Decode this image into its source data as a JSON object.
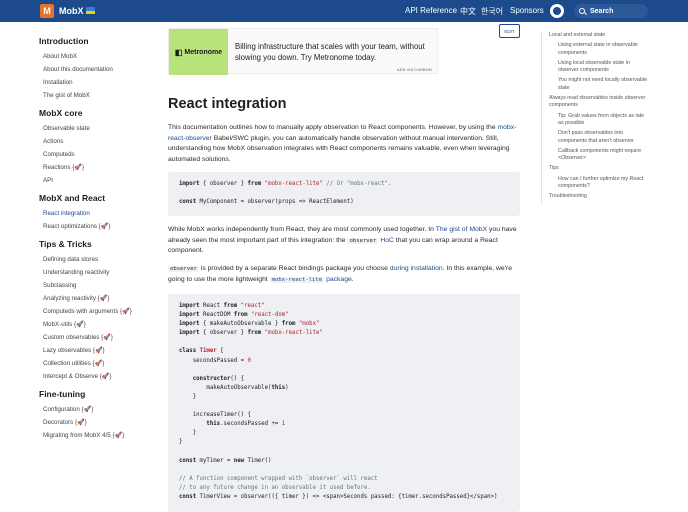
{
  "navbar": {
    "brand": "MobX",
    "links": [
      "API Reference",
      "中文",
      "한국어",
      "Sponsors"
    ],
    "search_label": "Search",
    "logo_icon": "mobx-logo-icon",
    "github_icon": "github-icon"
  },
  "sidebar": {
    "sections": [
      {
        "title": "Introduction",
        "items": [
          "About MobX",
          "About this documentation",
          "Installation",
          "The gist of MobX"
        ]
      },
      {
        "title": "MobX core",
        "items": [
          "Observable state",
          "Actions",
          "Computeds",
          "Reactions {🚀}",
          "API"
        ]
      },
      {
        "title": "MobX and React",
        "items": [
          "React integration",
          "React optimizations {🚀}"
        ]
      },
      {
        "title": "Tips & Tricks",
        "items": [
          "Defining data stores",
          "Understanding reactivity",
          "Subclassing",
          "Analyzing reactivity {🚀}",
          "Computeds with arguments {🚀}",
          "MobX-utils {🚀}",
          "Custom observables {🚀}",
          "Lazy observables {🚀}",
          "Collection utilities {🚀}",
          "Intercept & Observe {🚀}"
        ]
      },
      {
        "title": "Fine-tuning",
        "items": [
          "Configuration {🚀}",
          "Decorators {🚀}",
          "Migrating from MobX 4/5 {🚀}"
        ]
      }
    ],
    "active_item": "React integration"
  },
  "ad": {
    "brand": "Metronome",
    "text": "Billing infrastructure that scales with your team, without slowing you down. Try Metronome today.",
    "via": "ADS VIA CARBON"
  },
  "edit_label": "EDIT",
  "page": {
    "title": "React integration",
    "p1_a": "This documentation outlines how to manually apply observation to React components. However, by using the ",
    "p1_link": "mobx-react-observer",
    "p1_b": " Babel/SWC plugin, you can automatically handle observation without manual intervention. Still, understanding how MobX observation integrates with React components remains valuable, even when leveraging automated solutions.",
    "p2_a": "While MobX works independently from React, they are most commonly used together. In ",
    "p2_link1": "The gist of MobX",
    "p2_b": " you have already seen the most important part of this integration: the ",
    "p2_code": "observer",
    "p2_link2": "HoC",
    "p2_c": " that you can wrap around a React component.",
    "p3_code1": "observer",
    "p3_a": " is provided by a separate React bindings package you choose ",
    "p3_link": "during installation",
    "p3_b": ". In this example, we're going to use the more lightweight ",
    "p3_code2": "mobx-react-lite",
    "p3_link2": "package"
  },
  "code1": [
    "import { observer } from \"mobx-react-lite\" // Or \"mobx-react\".",
    "",
    "const MyComponent = observer(props => ReactElement)"
  ],
  "code2": [
    "import React from \"react\"",
    "import ReactDOM from \"react-dom\"",
    "import { makeAutoObservable } from \"mobx\"",
    "import { observer } from \"mobx-react-lite\"",
    "",
    "class Timer {",
    "    secondsPassed = 0",
    "",
    "    constructor() {",
    "        makeAutoObservable(this)",
    "    }",
    "",
    "    increaseTimer() {",
    "        this.secondsPassed += 1",
    "    }",
    "}",
    "",
    "const myTimer = new Timer()",
    "",
    "// A function component wrapped with `observer` will react",
    "// to any future change in an observable it used before.",
    "const TimerView = observer(({ timer }) => <span>Seconds passed: {timer.secondsPassed}</span>)"
  ],
  "toc": [
    {
      "label": "Local and external state",
      "level": 1
    },
    {
      "label": "Using external state in observable components",
      "level": 2
    },
    {
      "label": "Using local observable state in observer components",
      "level": 2
    },
    {
      "label": "You might not need locally observable state",
      "level": 2
    },
    {
      "label": "Always read observables inside observer components",
      "level": 1
    },
    {
      "label": "Tip: Grab values from objects as late as possible",
      "level": 2
    },
    {
      "label": "Don't pass observables into components that aren't observer",
      "level": 2
    },
    {
      "label": "Callback components might require <Observer>",
      "level": 2
    },
    {
      "label": "Tips",
      "level": 1
    },
    {
      "label": "How can I further optimize my React components?",
      "level": 2
    },
    {
      "label": "Troubleshooting",
      "level": 1
    }
  ]
}
